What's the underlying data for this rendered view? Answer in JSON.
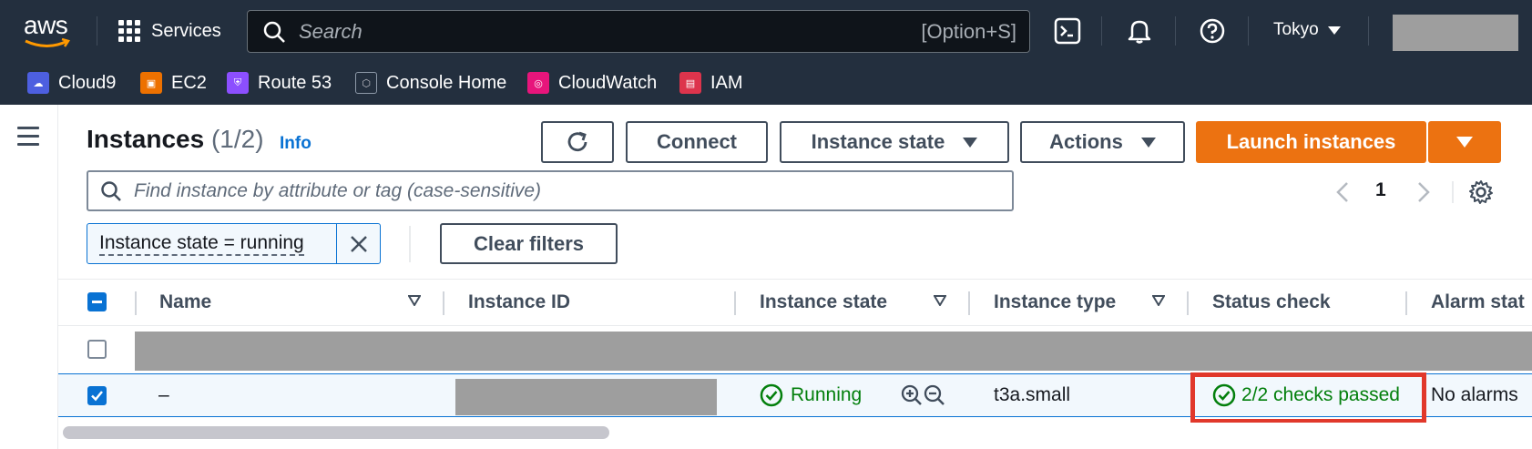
{
  "topnav": {
    "services_label": "Services",
    "search_placeholder": "Search",
    "search_shortcut": "[Option+S]",
    "region": "Tokyo"
  },
  "favorites": [
    {
      "label": "Cloud9",
      "color": "#4d5fe0"
    },
    {
      "label": "EC2",
      "color": "#ed7100"
    },
    {
      "label": "Route 53",
      "color": "#8c4fff"
    },
    {
      "label": "Console Home",
      "color": "#232f3e"
    },
    {
      "label": "CloudWatch",
      "color": "#e7157b"
    },
    {
      "label": "IAM",
      "color": "#dd344c"
    }
  ],
  "header": {
    "title": "Instances",
    "count": "(1/2)",
    "info": "Info"
  },
  "toolbar": {
    "connect": "Connect",
    "instance_state": "Instance state",
    "actions": "Actions",
    "launch": "Launch instances"
  },
  "filter": {
    "placeholder": "Find instance by attribute or tag (case-sensitive)",
    "token": "Instance state = running",
    "clear": "Clear filters"
  },
  "pagination": {
    "current_page": "1"
  },
  "table": {
    "columns": [
      "Name",
      "Instance ID",
      "Instance state",
      "Instance type",
      "Status check",
      "Alarm stat"
    ],
    "rows": [
      {
        "selected": false,
        "redacted": true
      },
      {
        "selected": true,
        "name": "–",
        "instance_id": "",
        "state": "Running",
        "type": "t3a.small",
        "status_check": "2/2 checks passed",
        "alarm": "No alarms"
      }
    ]
  },
  "colors": {
    "nav_bg": "#232f3e",
    "primary": "#ec7211",
    "link": "#0972d3",
    "success": "#037f0c",
    "highlight": "#e1382b"
  }
}
